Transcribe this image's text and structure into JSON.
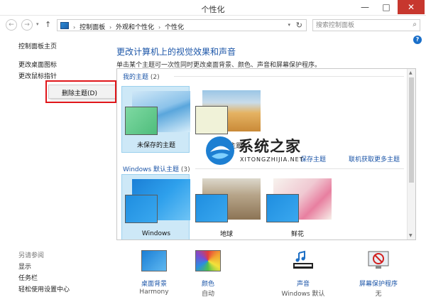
{
  "window": {
    "title": "个性化",
    "min": "—",
    "max": "□",
    "close": "✕"
  },
  "nav": {
    "back": "←",
    "forward": "→",
    "dropdown": "▾",
    "up": "↑",
    "breadcrumb": [
      "控制面板",
      "外观和个性化",
      "个性化"
    ],
    "separator": "›",
    "refresh": "↻",
    "search_placeholder": "搜索控制面板",
    "search_icon": "⌕"
  },
  "help": "?",
  "sidebar": {
    "home": "控制面板主页",
    "desktop_icons": "更改桌面图标",
    "mouse_pointers": "更改鼠标指针",
    "see_also": "另请参阅",
    "display": "显示",
    "taskbar": "任务栏",
    "ease_of_access": "轻松使用设置中心"
  },
  "context_menu": {
    "delete_theme": "删除主题(D)"
  },
  "main": {
    "title": "更改计算机上的视觉效果和声音",
    "description": "单击某个主题可一次性同时更改桌面背景、颜色、声音和屏幕保护程序。"
  },
  "themes": {
    "my_group_label": "我的主题",
    "my_group_count": "(2)",
    "my_themes": [
      {
        "name": "未保存的主题",
        "swatch_color": "#5fc98a",
        "selected": true
      },
      {
        "name": "同步的主题",
        "swatch_color": "#f0f2d8",
        "selected": false
      }
    ],
    "links": [
      "保存主题",
      "联机获取更多主题"
    ],
    "windows_group_label": "Windows 默认主题",
    "windows_group_count": "(3)",
    "windows_themes": [
      {
        "name": "Windows",
        "selected": true
      },
      {
        "name": "地球",
        "selected": false
      },
      {
        "name": "鲜花",
        "selected": false
      }
    ]
  },
  "bottom": [
    {
      "label": "桌面背景",
      "value": "Harmony",
      "icon": "desktop-background-icon"
    },
    {
      "label": "颜色",
      "value": "自动",
      "icon": "color-icon"
    },
    {
      "label": "声音",
      "value": "Windows 默认",
      "icon": "sound-icon"
    },
    {
      "label": "屏幕保护程序",
      "value": "无",
      "icon": "screensaver-icon"
    }
  ],
  "watermark": {
    "text": "系统之家",
    "sub": "XITONGZHIJIA.NET"
  },
  "colors": {
    "accent_link": "#1c56a8",
    "selection": "#cde8f7",
    "close_button": "#c7372e",
    "highlight_box": "#e0161a"
  }
}
